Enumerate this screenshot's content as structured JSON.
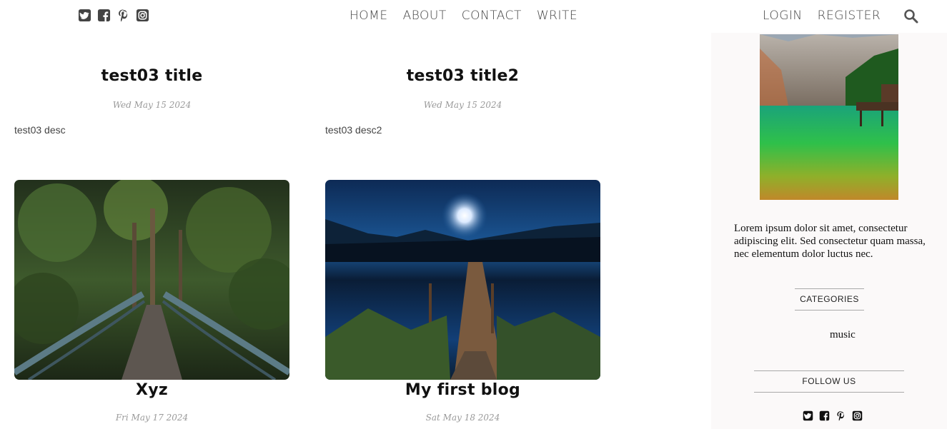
{
  "nav": {
    "social_icons": [
      "twitter-square-icon",
      "facebook-square-icon",
      "pinterest-icon",
      "instagram-icon"
    ],
    "links": [
      "HOME",
      "ABOUT",
      "CONTACT",
      "WRITE"
    ],
    "auth": [
      "LOGIN",
      "REGISTER"
    ],
    "search_icon": "search-icon"
  },
  "posts": [
    {
      "title": "test03 title",
      "date": "Wed May 15 2024",
      "desc": "test03 desc"
    },
    {
      "title": "test03 title2",
      "date": "Wed May 15 2024",
      "desc": "test03 desc2"
    },
    {
      "title": "Xyz",
      "date": "Fri May 17 2024",
      "image": "forest-bridge-image"
    },
    {
      "title": "My first blog",
      "date": "Sat May 18 2024",
      "image": "moonlit-lake-pier-image"
    }
  ],
  "sidebar": {
    "image": "mountain-lake-image",
    "about": "Lorem ipsum dolor sit amet, consectetur adipiscing elit. Sed consectetur quam massa, nec elementum dolor luctus nec.",
    "categories_title": "CATEGORIES",
    "categories": [
      "music"
    ],
    "follow_title": "FOLLOW US"
  },
  "colors": {
    "text": "#444444",
    "date": "#9a9a9a",
    "sidebar_bg": "#fbf9f9"
  }
}
